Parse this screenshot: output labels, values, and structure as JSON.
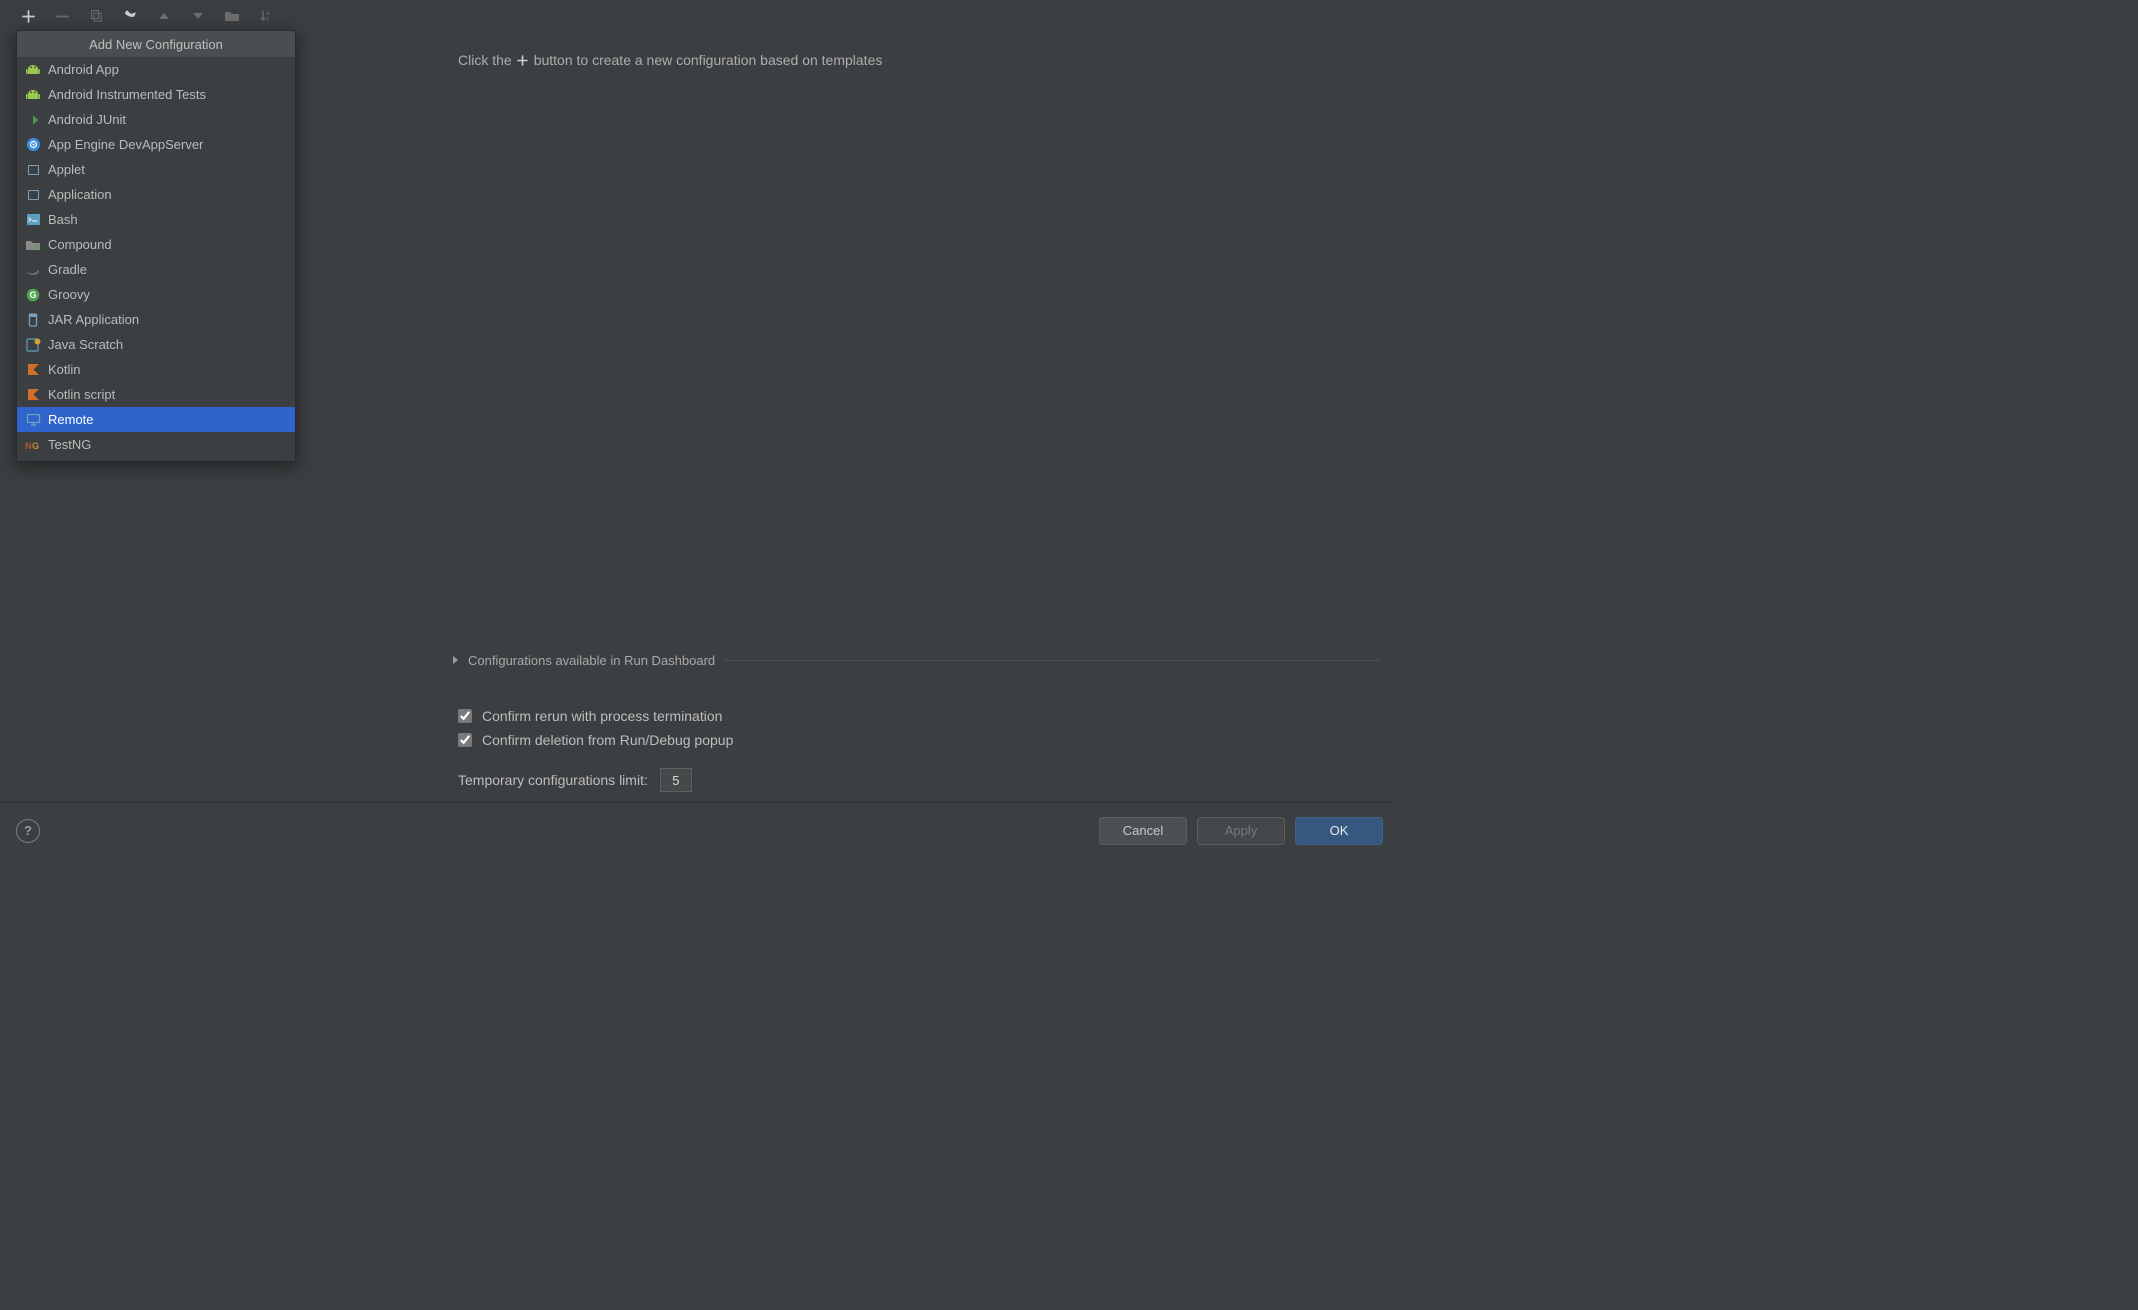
{
  "popup": {
    "title": "Add New Configuration",
    "items": [
      {
        "label": "Android App",
        "icon": "android",
        "color": "#9ac851"
      },
      {
        "label": "Android Instrumented Tests",
        "icon": "android",
        "color": "#9ac851"
      },
      {
        "label": "Android JUnit",
        "icon": "junit",
        "color": "#e0963c"
      },
      {
        "label": "App Engine DevAppServer",
        "icon": "appengine",
        "color": "#3b8ee0"
      },
      {
        "label": "Applet",
        "icon": "window",
        "color": "#7aa0c0"
      },
      {
        "label": "Application",
        "icon": "window",
        "color": "#7aa0c0"
      },
      {
        "label": "Bash",
        "icon": "terminal",
        "color": "#5aa0c0"
      },
      {
        "label": "Compound",
        "icon": "compound",
        "color": "#8a8a8a"
      },
      {
        "label": "Gradle",
        "icon": "gradle",
        "color": "#6e6e6e"
      },
      {
        "label": "Groovy",
        "icon": "groovy",
        "color": "#4fa24f"
      },
      {
        "label": "JAR Application",
        "icon": "jar",
        "color": "#7aa0c0"
      },
      {
        "label": "Java Scratch",
        "icon": "scratch",
        "color": "#5aa0c0"
      },
      {
        "label": "Kotlin",
        "icon": "kotlin",
        "color": "#d06e2a"
      },
      {
        "label": "Kotlin script",
        "icon": "kotlin",
        "color": "#d06e2a"
      },
      {
        "label": "Remote",
        "icon": "remote",
        "color": "#7aa0c0",
        "selected": true
      },
      {
        "label": "TestNG",
        "icon": "testng",
        "color": "#c87a38"
      }
    ]
  },
  "right": {
    "hint_prefix": "Click the",
    "hint_suffix": "button to create a new configuration based on templates",
    "dashboard_label": "Configurations available in Run Dashboard",
    "confirm_rerun": "Confirm rerun with process termination",
    "confirm_delete": "Confirm deletion from Run/Debug popup",
    "limit_label": "Temporary configurations limit:",
    "limit_value": "5"
  },
  "footer": {
    "cancel": "Cancel",
    "apply": "Apply",
    "ok": "OK"
  }
}
